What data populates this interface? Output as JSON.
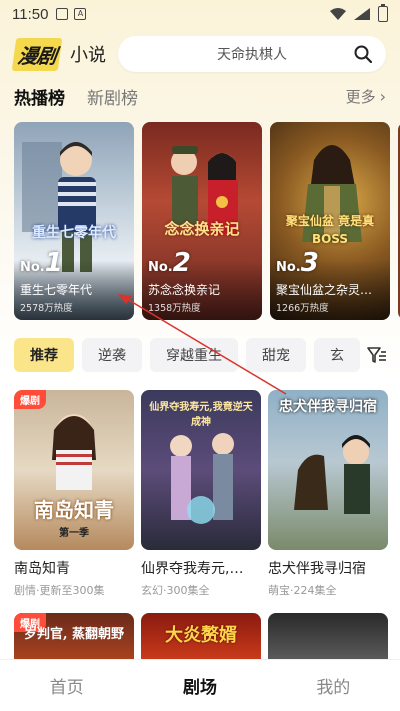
{
  "status_bar": {
    "time": "11:50",
    "icon_a": "A"
  },
  "header": {
    "logo": "漫剧",
    "logo_sub": "小说",
    "search_placeholder": "天命执棋人"
  },
  "tabs": [
    {
      "label": "热播榜",
      "active": true
    },
    {
      "label": "新剧榜",
      "active": false
    }
  ],
  "more_label": "更多",
  "ranking": [
    {
      "no_prefix": "No.",
      "rank": "1",
      "cover_title": "重生七零年代",
      "title": "重生七零年代",
      "heat": "2578万热度"
    },
    {
      "no_prefix": "No.",
      "rank": "2",
      "cover_title": "念念换亲记",
      "title": "苏念念换亲记",
      "heat": "1358万热度"
    },
    {
      "no_prefix": "No.",
      "rank": "3",
      "cover_title": "聚宝仙盆 竟是真BOSS",
      "title": "聚宝仙盆之杂灵…",
      "heat": "1266万热度"
    }
  ],
  "chips": [
    {
      "label": "推荐",
      "active": true
    },
    {
      "label": "逆袭",
      "active": false
    },
    {
      "label": "穿越重生",
      "active": false
    },
    {
      "label": "甜宠",
      "active": false
    },
    {
      "label": "玄",
      "active": false
    }
  ],
  "grid": [
    {
      "badge": "爆剧",
      "cover_text": "南岛知青",
      "cover_sub": "第一季",
      "title": "南岛知青",
      "meta": "剧情·更新至300集"
    },
    {
      "badge": "",
      "cover_text": "仙界夺我寿元,我竟逆天成神",
      "cover_sub": "",
      "title": "仙界夺我寿元,…",
      "meta": "玄幻·300集全"
    },
    {
      "badge": "",
      "cover_text": "忠犬伴我寻归宿",
      "cover_sub": "",
      "title": "忠犬伴我寻归宿",
      "meta": "萌宝·224集全"
    }
  ],
  "row2": [
    {
      "badge": "爆剧",
      "cover_text": "岁判官, 蒸翻朝野"
    },
    {
      "badge": "",
      "cover_text": "大炎赘婿"
    },
    {
      "badge": "",
      "cover_text": ""
    }
  ],
  "bottom_nav": [
    {
      "label": "首页",
      "active": false
    },
    {
      "label": "剧场",
      "active": true
    },
    {
      "label": "我的",
      "active": false
    }
  ],
  "colors": {
    "accent": "#fbe58a",
    "badge": "#ff4d3a",
    "arrow": "#d9342b"
  },
  "icons": {
    "search": "search-icon",
    "filter": "filter-icon",
    "chevron": "chevron-right-icon"
  }
}
